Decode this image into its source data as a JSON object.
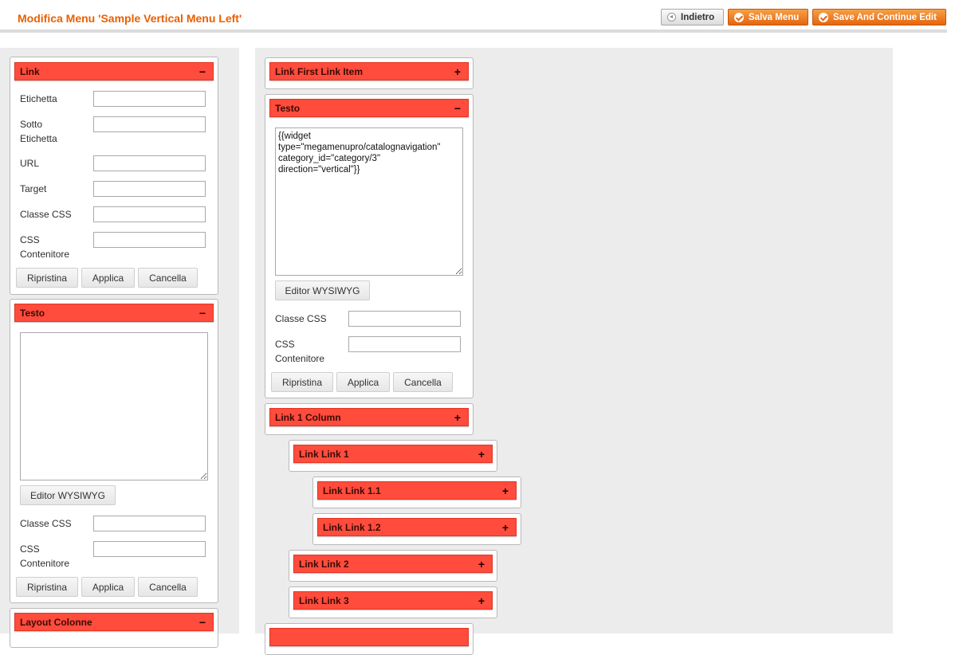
{
  "header": {
    "title": "Modifica Menu 'Sample Vertical Menu Left'",
    "back_label": "Indietro",
    "save_label": "Salva Menu",
    "save_continue_label": "Save And Continue Edit",
    "accent_color": "#eb5e00"
  },
  "left": {
    "link_section": {
      "title": "Link",
      "toggle": "−",
      "fields": {
        "label": "Etichetta",
        "sub_label_1": "Sotto",
        "sub_label_2": "Etichetta",
        "url": "URL",
        "target": "Target",
        "css_class": "Classe CSS",
        "css_container_1": "CSS",
        "css_container_2": "Contenitore"
      },
      "buttons": {
        "reset": "Ripristina",
        "apply": "Applica",
        "delete": "Cancella"
      }
    },
    "text_section": {
      "title": "Testo",
      "toggle": "−",
      "textarea_value": "",
      "wysiwyg": "Editor WYSIWYG",
      "css_class": "Classe CSS",
      "css_container_1": "CSS",
      "css_container_2": "Contenitore",
      "buttons": {
        "reset": "Ripristina",
        "apply": "Applica",
        "delete": "Cancella"
      }
    },
    "layout_section": {
      "title": "Layout Colonne",
      "toggle": "−"
    }
  },
  "main": {
    "items": [
      {
        "title": "Link First Link Item",
        "toggle": "+"
      },
      {
        "title": "Testo",
        "toggle": "−",
        "textarea_value": "{{widget\ntype=\"megamenupro/catalognavigation\"\ncategory_id=\"category/3\"\ndirection=\"vertical\"}}",
        "wysiwyg": "Editor WYSIWYG",
        "css_class": "Classe CSS",
        "css_container_1": "CSS",
        "css_container_2": "Contenitore",
        "buttons": {
          "reset": "Ripristina",
          "apply": "Applica",
          "delete": "Cancella"
        }
      },
      {
        "title": "Link 1 Column",
        "toggle": "+"
      },
      {
        "title": "Link Link 1",
        "toggle": "+"
      },
      {
        "title": "Link Link 1.1",
        "toggle": "+"
      },
      {
        "title": "Link Link 1.2",
        "toggle": "+"
      },
      {
        "title": "Link Link 2",
        "toggle": "+"
      },
      {
        "title": "Link Link 3",
        "toggle": "+"
      }
    ]
  },
  "colors": {
    "bar": "#ff4c3c",
    "panel": "#ececec"
  }
}
